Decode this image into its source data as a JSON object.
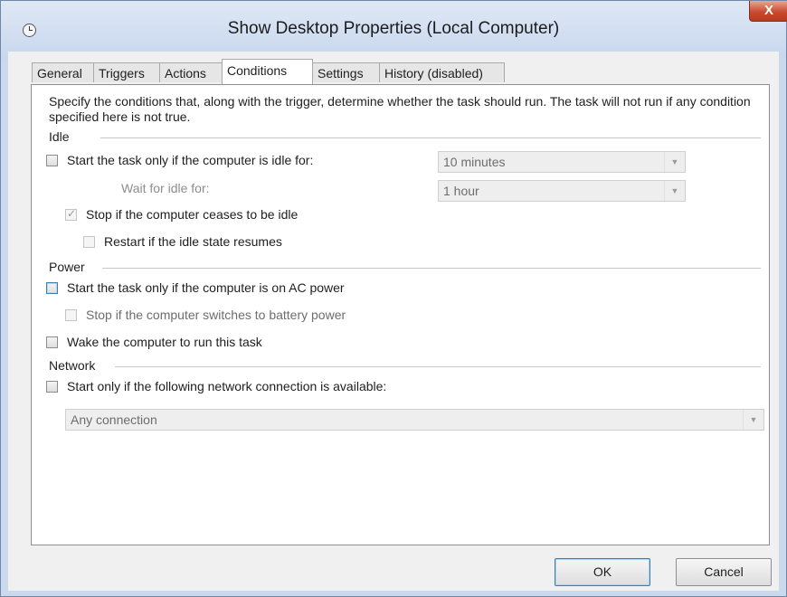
{
  "window": {
    "title": "Show Desktop Properties (Local Computer)",
    "close_label": "X"
  },
  "tabs": [
    {
      "label": "General"
    },
    {
      "label": "Triggers"
    },
    {
      "label": "Actions"
    },
    {
      "label": "Conditions",
      "active": true
    },
    {
      "label": "Settings"
    },
    {
      "label": "History (disabled)"
    }
  ],
  "intro_text": "Specify the conditions that, along with the trigger, determine whether the task should run.  The task will not run  if any condition specified here is not true.",
  "idle": {
    "label": "Idle",
    "start_if_idle": {
      "label": "Start the task only if the computer is idle for:",
      "checked": false
    },
    "idle_duration": {
      "value": "10 minutes"
    },
    "wait_for_idle_label": "Wait for idle for:",
    "wait_duration": {
      "value": "1 hour"
    },
    "stop_if_ceases": {
      "label": "Stop if the computer ceases to be idle",
      "checked": true
    },
    "restart_if_resumes": {
      "label": "Restart if the idle state resumes",
      "checked": false
    }
  },
  "power": {
    "label": "Power",
    "start_on_ac": {
      "label": "Start the task only if the computer is on AC power",
      "checked": false
    },
    "stop_on_battery": {
      "label": "Stop if the computer switches to battery power",
      "checked": false
    },
    "wake_to_run": {
      "label": "Wake the computer to run this task",
      "checked": false
    }
  },
  "network": {
    "label": "Network",
    "start_if_network": {
      "label": "Start only if the following network connection is available:",
      "checked": false
    },
    "connection": {
      "value": "Any connection"
    }
  },
  "buttons": {
    "ok": "OK",
    "cancel": "Cancel"
  }
}
